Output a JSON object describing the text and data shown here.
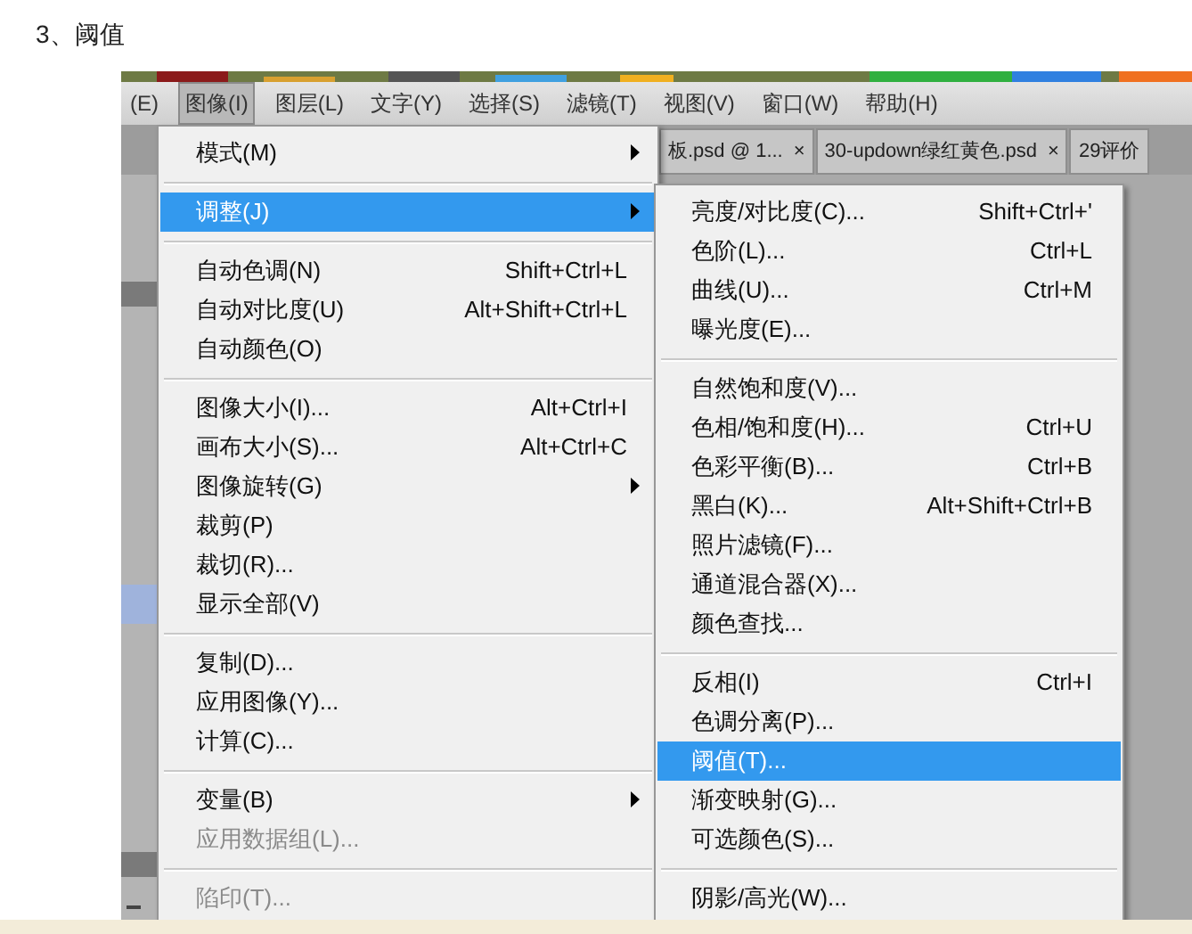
{
  "heading": "3、阈值",
  "menu_bar": [
    {
      "label": "(E)",
      "selected": false
    },
    {
      "label": "图像(I)",
      "selected": true
    },
    {
      "label": "图层(L)",
      "selected": false
    },
    {
      "label": "文字(Y)",
      "selected": false
    },
    {
      "label": "选择(S)",
      "selected": false
    },
    {
      "label": "滤镜(T)",
      "selected": false
    },
    {
      "label": "视图(V)",
      "selected": false
    },
    {
      "label": "窗口(W)",
      "selected": false
    },
    {
      "label": "帮助(H)",
      "selected": false
    }
  ],
  "tabs": [
    {
      "label": "板.psd @ 1...",
      "close": "×"
    },
    {
      "label": "30-updown绿红黄色.psd",
      "close": "×"
    },
    {
      "label": "29评价"
    }
  ],
  "menu": {
    "items": [
      {
        "kind": "item",
        "label": "模式(M)",
        "submenu": true,
        "selected": false,
        "disabled": false
      },
      {
        "kind": "separator"
      },
      {
        "kind": "item",
        "label": "调整(J)",
        "submenu": true,
        "selected": true,
        "disabled": false
      },
      {
        "kind": "separator"
      },
      {
        "kind": "item",
        "label": "自动色调(N)",
        "shortcut": "Shift+Ctrl+L",
        "selected": false,
        "disabled": false
      },
      {
        "kind": "item",
        "label": "自动对比度(U)",
        "shortcut": "Alt+Shift+Ctrl+L",
        "selected": false,
        "disabled": false
      },
      {
        "kind": "item",
        "label": "自动颜色(O)",
        "selected": false,
        "disabled": false
      },
      {
        "kind": "separator"
      },
      {
        "kind": "item",
        "label": "图像大小(I)...",
        "shortcut": "Alt+Ctrl+I",
        "selected": false,
        "disabled": false
      },
      {
        "kind": "item",
        "label": "画布大小(S)...",
        "shortcut": "Alt+Ctrl+C",
        "selected": false,
        "disabled": false
      },
      {
        "kind": "item",
        "label": "图像旋转(G)",
        "submenu": true,
        "selected": false,
        "disabled": false
      },
      {
        "kind": "item",
        "label": "裁剪(P)",
        "selected": false,
        "disabled": false
      },
      {
        "kind": "item",
        "label": "裁切(R)...",
        "selected": false,
        "disabled": false
      },
      {
        "kind": "item",
        "label": "显示全部(V)",
        "selected": false,
        "disabled": false
      },
      {
        "kind": "separator"
      },
      {
        "kind": "item",
        "label": "复制(D)...",
        "selected": false,
        "disabled": false
      },
      {
        "kind": "item",
        "label": "应用图像(Y)...",
        "selected": false,
        "disabled": false
      },
      {
        "kind": "item",
        "label": "计算(C)...",
        "selected": false,
        "disabled": false
      },
      {
        "kind": "separator"
      },
      {
        "kind": "item",
        "label": "变量(B)",
        "submenu": true,
        "selected": false,
        "disabled": false
      },
      {
        "kind": "item",
        "label": "应用数据组(L)...",
        "selected": false,
        "disabled": true
      },
      {
        "kind": "separator"
      },
      {
        "kind": "item",
        "label": "陷印(T)...",
        "selected": false,
        "disabled": true
      }
    ]
  },
  "submenu": {
    "items": [
      {
        "kind": "item",
        "label": "亮度/对比度(C)...",
        "shortcut": "Shift+Ctrl+'",
        "selected": false
      },
      {
        "kind": "item",
        "label": "色阶(L)...",
        "shortcut": "Ctrl+L",
        "selected": false
      },
      {
        "kind": "item",
        "label": "曲线(U)...",
        "shortcut": "Ctrl+M",
        "selected": false
      },
      {
        "kind": "item",
        "label": "曝光度(E)...",
        "selected": false
      },
      {
        "kind": "separator"
      },
      {
        "kind": "item",
        "label": "自然饱和度(V)...",
        "selected": false
      },
      {
        "kind": "item",
        "label": "色相/饱和度(H)...",
        "shortcut": "Ctrl+U",
        "selected": false
      },
      {
        "kind": "item",
        "label": "色彩平衡(B)...",
        "shortcut": "Ctrl+B",
        "selected": false
      },
      {
        "kind": "item",
        "label": "黑白(K)...",
        "shortcut": "Alt+Shift+Ctrl+B",
        "selected": false
      },
      {
        "kind": "item",
        "label": "照片滤镜(F)...",
        "selected": false
      },
      {
        "kind": "item",
        "label": "通道混合器(X)...",
        "selected": false
      },
      {
        "kind": "item",
        "label": "颜色查找...",
        "selected": false
      },
      {
        "kind": "separator"
      },
      {
        "kind": "item",
        "label": "反相(I)",
        "shortcut": "Ctrl+I",
        "selected": false
      },
      {
        "kind": "item",
        "label": "色调分离(P)...",
        "selected": false
      },
      {
        "kind": "item",
        "label": "阈值(T)...",
        "selected": true
      },
      {
        "kind": "item",
        "label": "渐变映射(G)...",
        "selected": false
      },
      {
        "kind": "item",
        "label": "可选颜色(S)...",
        "selected": false
      },
      {
        "kind": "separator"
      },
      {
        "kind": "item",
        "label": "阴影/高光(W)...",
        "selected": false
      }
    ]
  }
}
